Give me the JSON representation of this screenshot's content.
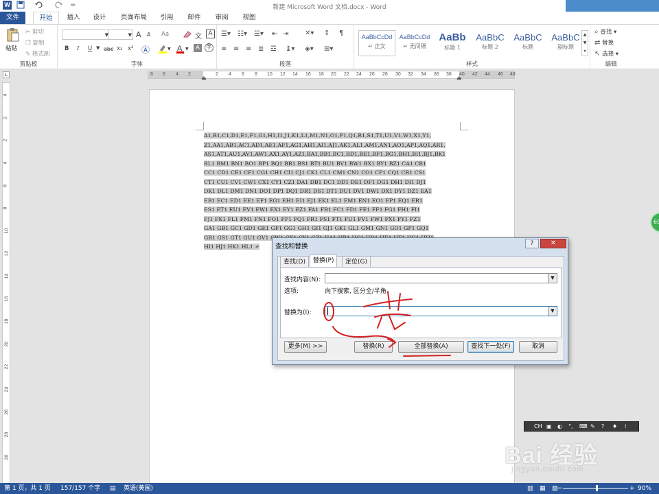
{
  "window": {
    "title": "新建 Microsoft Word 文档.docx - Word",
    "word_logo": "W"
  },
  "quick_access": {
    "save_icon": "save-icon",
    "undo_icon": "undo-icon",
    "redo_icon": "redo-icon",
    "customize": "="
  },
  "tabs": [
    "文件",
    "开始",
    "插入",
    "设计",
    "页面布局",
    "引用",
    "邮件",
    "审阅",
    "视图"
  ],
  "ribbon": {
    "clipboard": {
      "label": "剪贴板",
      "paste": "粘贴",
      "cut": "剪切",
      "copy": "复制",
      "format_painter": "格式刷"
    },
    "font": {
      "label": "字体",
      "grow": "A",
      "shrink": "A",
      "case": "Aa",
      "bold": "B",
      "italic": "I",
      "underline": "U",
      "strike": "abc",
      "subscript": "x₂",
      "superscript": "x²"
    },
    "paragraph": {
      "label": "段落"
    },
    "styles": {
      "label": "样式",
      "items": [
        {
          "sample": "AaBbCcDd",
          "name": "↵ 正文"
        },
        {
          "sample": "AaBbCcDd",
          "name": "↵ 无间隔"
        },
        {
          "sample": "AaBb",
          "name": "标题 1"
        },
        {
          "sample": "AaBbC",
          "name": "标题 2"
        },
        {
          "sample": "AaBbC",
          "name": "标题"
        },
        {
          "sample": "AaBbC",
          "name": "副标题"
        }
      ]
    },
    "editing": {
      "label": "编辑",
      "find": "查找",
      "replace": "替换",
      "select": "选择"
    }
  },
  "ruler": {
    "h_ticks": [
      "8",
      "6",
      "4",
      "2",
      "2",
      "4",
      "6",
      "8",
      "10",
      "12",
      "14",
      "16",
      "18",
      "20",
      "22",
      "24",
      "26",
      "28",
      "30",
      "32",
      "34",
      "36",
      "38",
      "40",
      "42",
      "44",
      "46",
      "48"
    ],
    "v_ticks": [
      "4",
      "2",
      "2",
      "4",
      "6",
      "8",
      "10",
      "12",
      "14",
      "16",
      "18",
      "20",
      "22",
      "24",
      "26",
      "28",
      "30"
    ]
  },
  "document": {
    "lines": [
      "A1,B1,C1,D1,E1,F1,G1,H1,I1,J1,K1,L1,M1,N1,O1,P1,Q1,R1,S1,T1,U1,V1,W1,X1,Y1,",
      "Z1,AA1,AB1,AC1,AD1,AE1,AF1,AG1,AH1,AI1,AJ1,AK1,AL1,AM1,AN1,AO1,AP1,AQ1,AR1,",
      "AS1,AT1,AU1,AV1,AW1,AX1,AY1,AZ1,BA1,BB1,BC1,BD1,BE1,BF1,BG1,BH1,BI1,BJ1,BK1",
      "BL1 BM1 BN1 BO1 BP1 BQ1 BR1 BS1 BT1 BU1 BV1 BW1 BX1 BY1 BZ1 CA1 CB1",
      "CC1 CD1 CE1 CF1 CG1 CH1 CI1 CJ1 CK1 CL1 CM1 CN1 CO1 CP1 CQ1 CR1 CS1",
      "CT1 CU1 CV1 CW1 CX1 CY1 CZ1 DA1 DB1 DC1 DD1 DE1 DF1 DG1 DH1 DI1 DJ1",
      "DK1 DL1 DM1 DN1 DO1 DP1 DQ1 DR1 DS1 DT1 DU1 DV1 DW1 DX1 DY1 DZ1 EA1",
      "EB1 EC1 ED1 EE1 EF1 EG1 EH1 EI1 EJ1 EK1 EL1 EM1 EN1 EO1 EP1 EQ1 ER1",
      "ES1 ET1 EU1 EV1 EW1 EX1 EY1 EZ1 FA1 FB1 FC1 FD1 FE1 FF1 FG1 FH1 FI1",
      "FJ1 FK1 FL1 FM1 FN1 FO1 FP1 FQ1 FR1 FS1 FT1 FU1 FV1 FW1 FX1 FY1 FZ1",
      "GA1 GB1 GC1 GD1 GE1 GF1 GG1 GH1 GI1 GJ1 GK1 GL1 GM1 GN1 GO1 GP1 GQ1",
      "GR1 GS1 GT1 GU1 GV1 GW1 GX1 GY1 GZ1 HA1 HB1 HC1 HD1 HE1 HF1 HG1 HH1",
      "HI1 HJ1 HK1 HL1 ↵"
    ],
    "paragraph_mark": "↵"
  },
  "dialog": {
    "title": "查找和替换",
    "help": "?",
    "close": "✕",
    "tabs": [
      "查找(D)",
      "替换(P)",
      "定位(G)"
    ],
    "find_label": "查找内容(N):",
    "find_value": "",
    "options_label": "选项:",
    "options_value": "向下搜索, 区分全/半角",
    "replace_label": "替换为(I):",
    "replace_value": "",
    "buttons": {
      "more": "更多(M) >>",
      "replace": "替换(R)",
      "replace_all": "全部替换(A)",
      "find_next": "查找下一处(F)",
      "cancel": "取消"
    }
  },
  "side_bubble": "69",
  "ime_toolbar": {
    "lang": "CH"
  },
  "watermark": {
    "main": "Bai 经验",
    "sub": "jingyan.baidu.com"
  },
  "status": {
    "page": "第 1 页，共 1 页",
    "words": "157/157 个字",
    "language": "英语(美国)",
    "zoom": "90%",
    "minus": "−",
    "plus": "+"
  },
  "colors": {
    "word_blue": "#2b579a",
    "annotation_red": "#d42020",
    "selection_grey": "#d0d0d0"
  }
}
